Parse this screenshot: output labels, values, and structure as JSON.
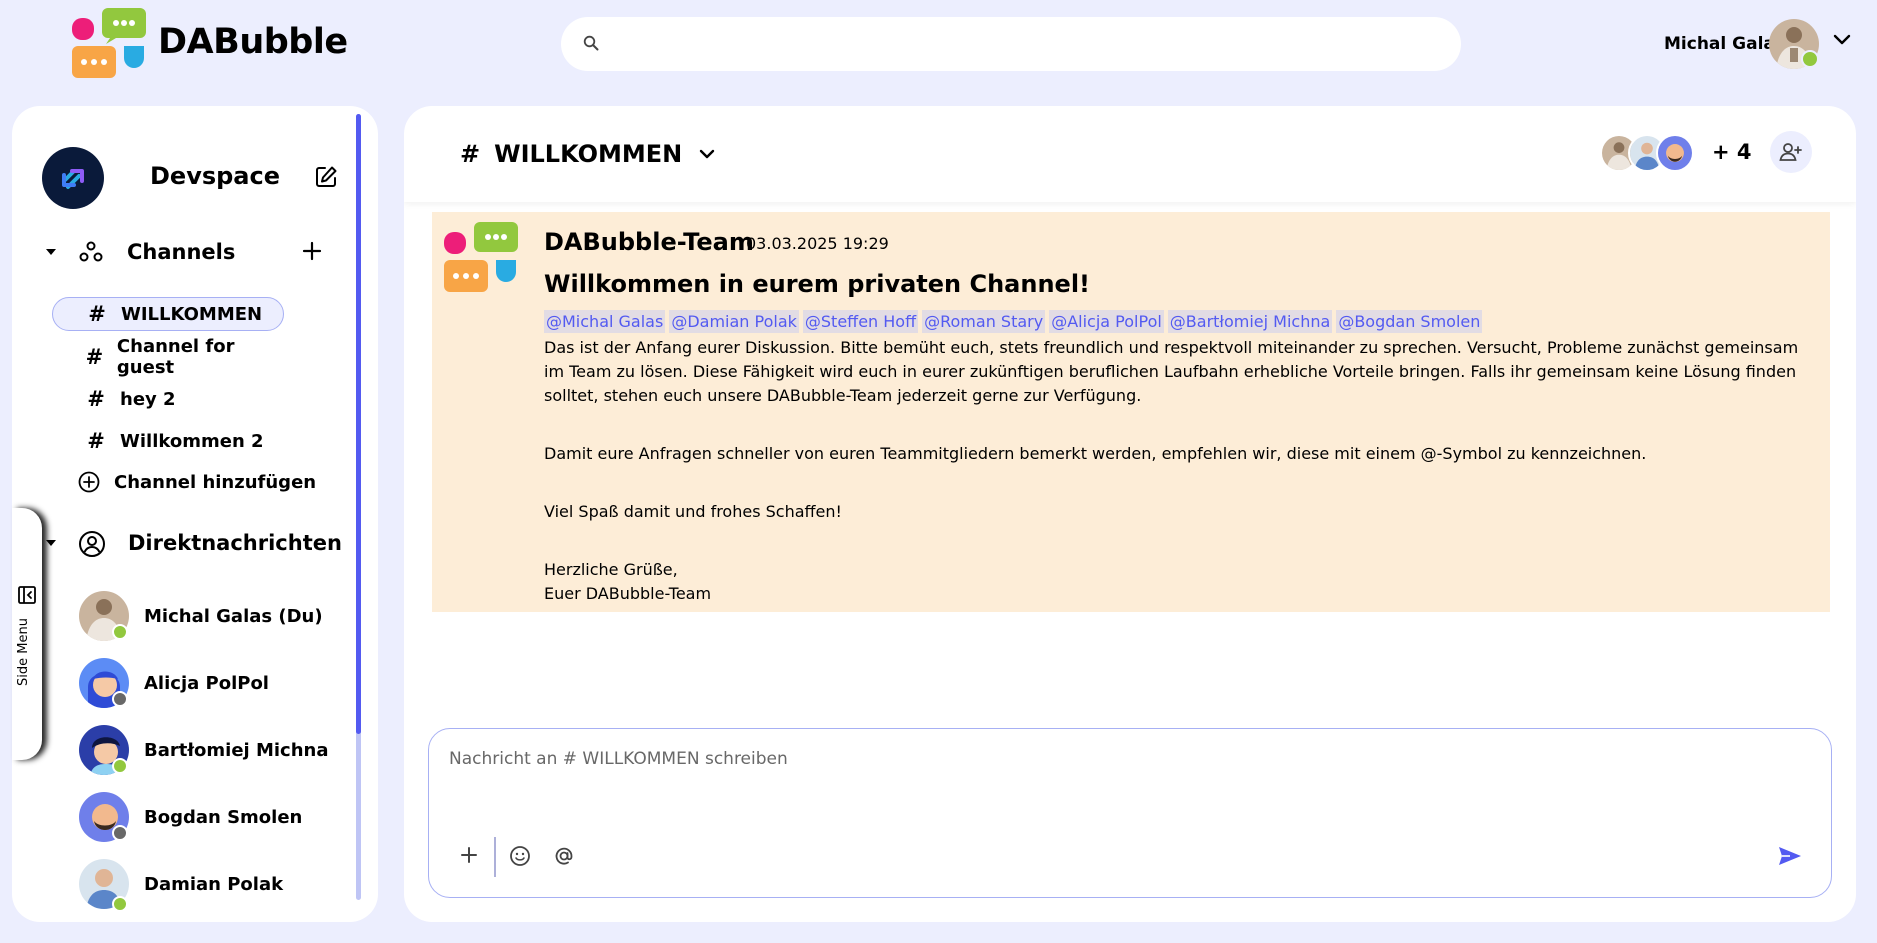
{
  "app": {
    "name": "DABubble"
  },
  "search": {
    "placeholder": ""
  },
  "user": {
    "name": "Michal Galas",
    "status": "online"
  },
  "workspace": {
    "name": "Devspace"
  },
  "channels": {
    "label": "Channels",
    "items": [
      {
        "label": "WILLKOMMEN",
        "active": true
      },
      {
        "label": "Channel for guest",
        "active": false
      },
      {
        "label": "hey 2",
        "active": false
      },
      {
        "label": "Willkommen 2",
        "active": false
      }
    ],
    "add_label": "Channel hinzufügen"
  },
  "direct_messages": {
    "label": "Direktnachrichten",
    "items": [
      {
        "name": "Michal Galas (Du)",
        "status": "online"
      },
      {
        "name": "Alicja PolPol",
        "status": "offline"
      },
      {
        "name": "Bartłomiej Michna",
        "status": "online"
      },
      {
        "name": "Bogdan Smolen",
        "status": "offline"
      },
      {
        "name": "Damian Polak",
        "status": "online"
      }
    ]
  },
  "side_menu_label": "Side Menu",
  "channel_header": {
    "hash": "#",
    "title": "WILLKOMMEN",
    "member_count": "+ 4"
  },
  "message": {
    "author": "DABubble-Team",
    "timestamp": "03.03.2025 19:29",
    "title": "Willkommen in eurem privaten Channel!",
    "mentions": [
      "@Michal Galas",
      "@Damian Polak",
      "@Steffen Hoff",
      "@Roman Stary",
      "@Alicja PolPol",
      "@Bartłomiej Michna",
      "@Bogdan Smolen"
    ],
    "paragraph1": "Das ist der Anfang eurer Diskussion. Bitte bemüht euch, stets freundlich und respektvoll miteinander zu sprechen. Versucht, Probleme zunächst gemeinsam im Team zu lösen. Diese Fähigkeit wird euch in eurer zukünftigen beruflichen Laufbahn erhebliche Vorteile bringen. Falls ihr gemeinsam keine Lösung finden solltet, stehen euch unsere DABubble-Team jederzeit gerne zur Verfügung.",
    "paragraph2": "Damit eure Anfragen schneller von euren Teammitgliedern bemerkt werden, empfehlen wir, diese mit einem @-Symbol zu kennzeichnen.",
    "paragraph3": "Viel Spaß damit und frohes Schaffen!",
    "closing1": "Herzliche Grüße,",
    "closing2": "Euer DABubble-Team"
  },
  "composer": {
    "placeholder": "Nachricht an # WILLKOMMEN schreiben"
  },
  "colors": {
    "background": "#ECEEFE",
    "accent": "#535AF1",
    "message_bg": "#FDEDD7",
    "online": "#92C83E",
    "offline": "#686868"
  }
}
